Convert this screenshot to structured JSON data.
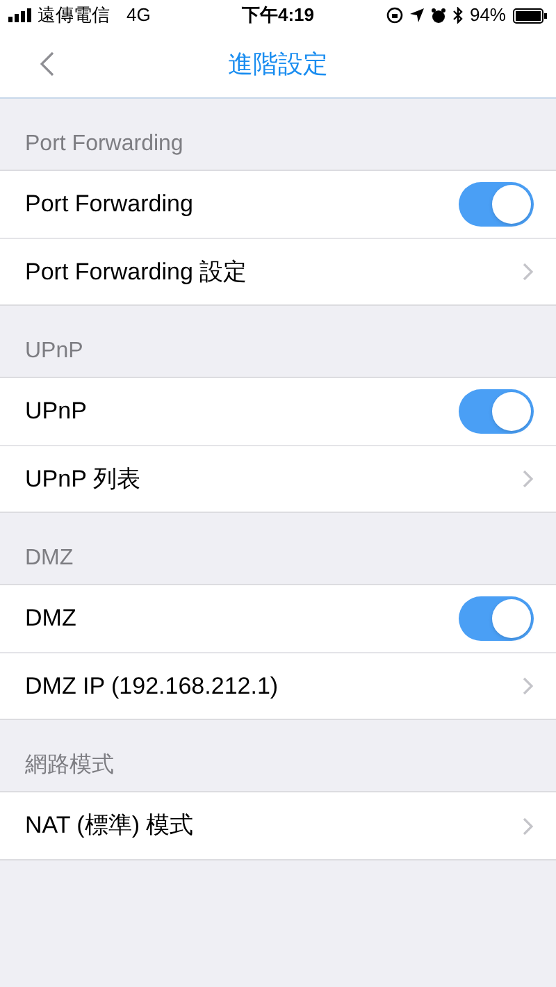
{
  "status_bar": {
    "carrier": "遠傳電信",
    "network": "4G",
    "time": "下午4:19",
    "battery": "94%"
  },
  "nav": {
    "title": "進階設定"
  },
  "sections": [
    {
      "header": "Port Forwarding",
      "rows": [
        {
          "kind": "toggle",
          "label": "Port Forwarding",
          "on": true
        },
        {
          "kind": "link",
          "label": "Port Forwarding 設定"
        }
      ]
    },
    {
      "header": "UPnP",
      "rows": [
        {
          "kind": "toggle",
          "label": "UPnP",
          "on": true
        },
        {
          "kind": "link",
          "label": "UPnP 列表"
        }
      ]
    },
    {
      "header": "DMZ",
      "rows": [
        {
          "kind": "toggle",
          "label": "DMZ",
          "on": true
        },
        {
          "kind": "link",
          "label": "DMZ IP (192.168.212.1)"
        }
      ]
    },
    {
      "header": "網路模式",
      "rows": [
        {
          "kind": "link",
          "label": "NAT (標準) 模式"
        }
      ]
    }
  ]
}
